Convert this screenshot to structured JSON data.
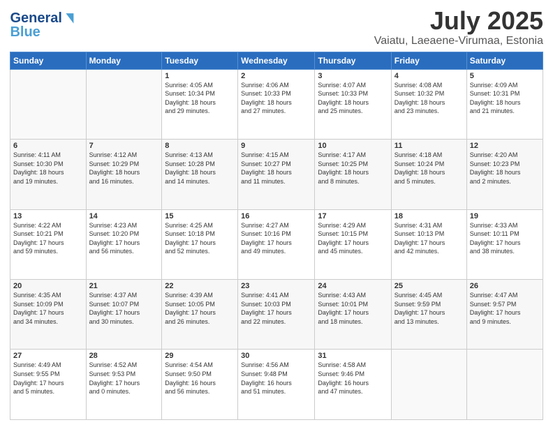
{
  "header": {
    "logo_line1": "General",
    "logo_line2": "Blue",
    "title": "July 2025",
    "location": "Vaiatu, Laeaene-Virumaa, Estonia"
  },
  "weekdays": [
    "Sunday",
    "Monday",
    "Tuesday",
    "Wednesday",
    "Thursday",
    "Friday",
    "Saturday"
  ],
  "weeks": [
    [
      {
        "day": "",
        "info": ""
      },
      {
        "day": "",
        "info": ""
      },
      {
        "day": "1",
        "info": "Sunrise: 4:05 AM\nSunset: 10:34 PM\nDaylight: 18 hours\nand 29 minutes."
      },
      {
        "day": "2",
        "info": "Sunrise: 4:06 AM\nSunset: 10:33 PM\nDaylight: 18 hours\nand 27 minutes."
      },
      {
        "day": "3",
        "info": "Sunrise: 4:07 AM\nSunset: 10:33 PM\nDaylight: 18 hours\nand 25 minutes."
      },
      {
        "day": "4",
        "info": "Sunrise: 4:08 AM\nSunset: 10:32 PM\nDaylight: 18 hours\nand 23 minutes."
      },
      {
        "day": "5",
        "info": "Sunrise: 4:09 AM\nSunset: 10:31 PM\nDaylight: 18 hours\nand 21 minutes."
      }
    ],
    [
      {
        "day": "6",
        "info": "Sunrise: 4:11 AM\nSunset: 10:30 PM\nDaylight: 18 hours\nand 19 minutes."
      },
      {
        "day": "7",
        "info": "Sunrise: 4:12 AM\nSunset: 10:29 PM\nDaylight: 18 hours\nand 16 minutes."
      },
      {
        "day": "8",
        "info": "Sunrise: 4:13 AM\nSunset: 10:28 PM\nDaylight: 18 hours\nand 14 minutes."
      },
      {
        "day": "9",
        "info": "Sunrise: 4:15 AM\nSunset: 10:27 PM\nDaylight: 18 hours\nand 11 minutes."
      },
      {
        "day": "10",
        "info": "Sunrise: 4:17 AM\nSunset: 10:25 PM\nDaylight: 18 hours\nand 8 minutes."
      },
      {
        "day": "11",
        "info": "Sunrise: 4:18 AM\nSunset: 10:24 PM\nDaylight: 18 hours\nand 5 minutes."
      },
      {
        "day": "12",
        "info": "Sunrise: 4:20 AM\nSunset: 10:23 PM\nDaylight: 18 hours\nand 2 minutes."
      }
    ],
    [
      {
        "day": "13",
        "info": "Sunrise: 4:22 AM\nSunset: 10:21 PM\nDaylight: 17 hours\nand 59 minutes."
      },
      {
        "day": "14",
        "info": "Sunrise: 4:23 AM\nSunset: 10:20 PM\nDaylight: 17 hours\nand 56 minutes."
      },
      {
        "day": "15",
        "info": "Sunrise: 4:25 AM\nSunset: 10:18 PM\nDaylight: 17 hours\nand 52 minutes."
      },
      {
        "day": "16",
        "info": "Sunrise: 4:27 AM\nSunset: 10:16 PM\nDaylight: 17 hours\nand 49 minutes."
      },
      {
        "day": "17",
        "info": "Sunrise: 4:29 AM\nSunset: 10:15 PM\nDaylight: 17 hours\nand 45 minutes."
      },
      {
        "day": "18",
        "info": "Sunrise: 4:31 AM\nSunset: 10:13 PM\nDaylight: 17 hours\nand 42 minutes."
      },
      {
        "day": "19",
        "info": "Sunrise: 4:33 AM\nSunset: 10:11 PM\nDaylight: 17 hours\nand 38 minutes."
      }
    ],
    [
      {
        "day": "20",
        "info": "Sunrise: 4:35 AM\nSunset: 10:09 PM\nDaylight: 17 hours\nand 34 minutes."
      },
      {
        "day": "21",
        "info": "Sunrise: 4:37 AM\nSunset: 10:07 PM\nDaylight: 17 hours\nand 30 minutes."
      },
      {
        "day": "22",
        "info": "Sunrise: 4:39 AM\nSunset: 10:05 PM\nDaylight: 17 hours\nand 26 minutes."
      },
      {
        "day": "23",
        "info": "Sunrise: 4:41 AM\nSunset: 10:03 PM\nDaylight: 17 hours\nand 22 minutes."
      },
      {
        "day": "24",
        "info": "Sunrise: 4:43 AM\nSunset: 10:01 PM\nDaylight: 17 hours\nand 18 minutes."
      },
      {
        "day": "25",
        "info": "Sunrise: 4:45 AM\nSunset: 9:59 PM\nDaylight: 17 hours\nand 13 minutes."
      },
      {
        "day": "26",
        "info": "Sunrise: 4:47 AM\nSunset: 9:57 PM\nDaylight: 17 hours\nand 9 minutes."
      }
    ],
    [
      {
        "day": "27",
        "info": "Sunrise: 4:49 AM\nSunset: 9:55 PM\nDaylight: 17 hours\nand 5 minutes."
      },
      {
        "day": "28",
        "info": "Sunrise: 4:52 AM\nSunset: 9:53 PM\nDaylight: 17 hours\nand 0 minutes."
      },
      {
        "day": "29",
        "info": "Sunrise: 4:54 AM\nSunset: 9:50 PM\nDaylight: 16 hours\nand 56 minutes."
      },
      {
        "day": "30",
        "info": "Sunrise: 4:56 AM\nSunset: 9:48 PM\nDaylight: 16 hours\nand 51 minutes."
      },
      {
        "day": "31",
        "info": "Sunrise: 4:58 AM\nSunset: 9:46 PM\nDaylight: 16 hours\nand 47 minutes."
      },
      {
        "day": "",
        "info": ""
      },
      {
        "day": "",
        "info": ""
      }
    ]
  ]
}
